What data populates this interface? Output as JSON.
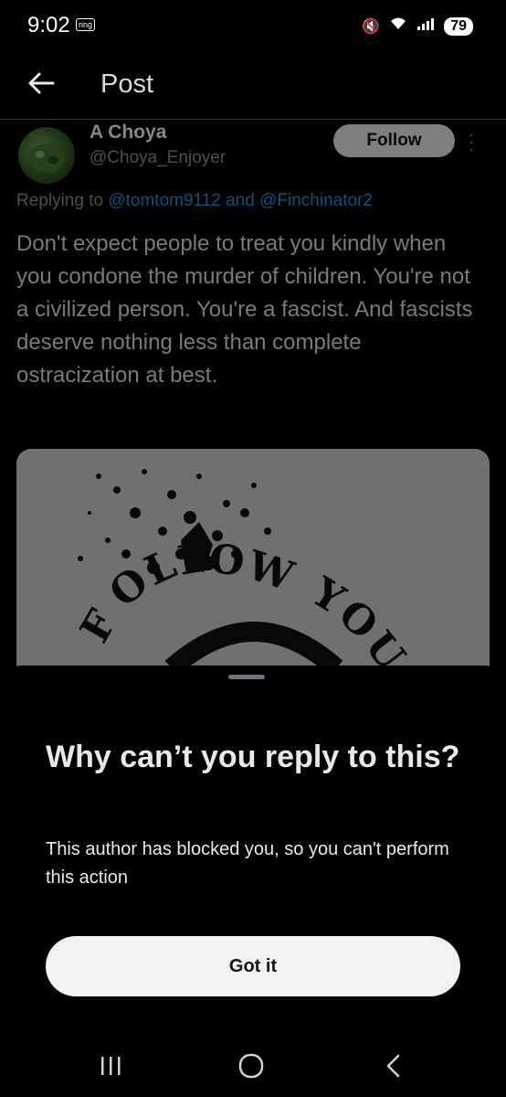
{
  "status_bar": {
    "time": "9:02",
    "ring_label": "ring",
    "battery": "79"
  },
  "app_bar": {
    "title": "Post"
  },
  "post": {
    "author_name": "A Choya",
    "author_handle": "@Choya_Enjoyer",
    "follow_label": "Follow",
    "replying_prefix": "Replying to ",
    "replying_mentions": "@tomtom9112 and @Finchinator2",
    "text": "Don't expect people to treat you kindly when you condone the murder of children. You're not a civilized person. You're a fascist. And fascists deserve nothing less than complete ostracization at best.",
    "media_text": "FOLLOW YOUR"
  },
  "sheet": {
    "title": "Why can’t you reply to this?",
    "description": "This author has blocked you, so you can't perform this action",
    "button_label": "Got it"
  },
  "icons": [
    "back-arrow-icon",
    "more-icon",
    "recents-icon",
    "home-icon",
    "nav-back-icon"
  ]
}
